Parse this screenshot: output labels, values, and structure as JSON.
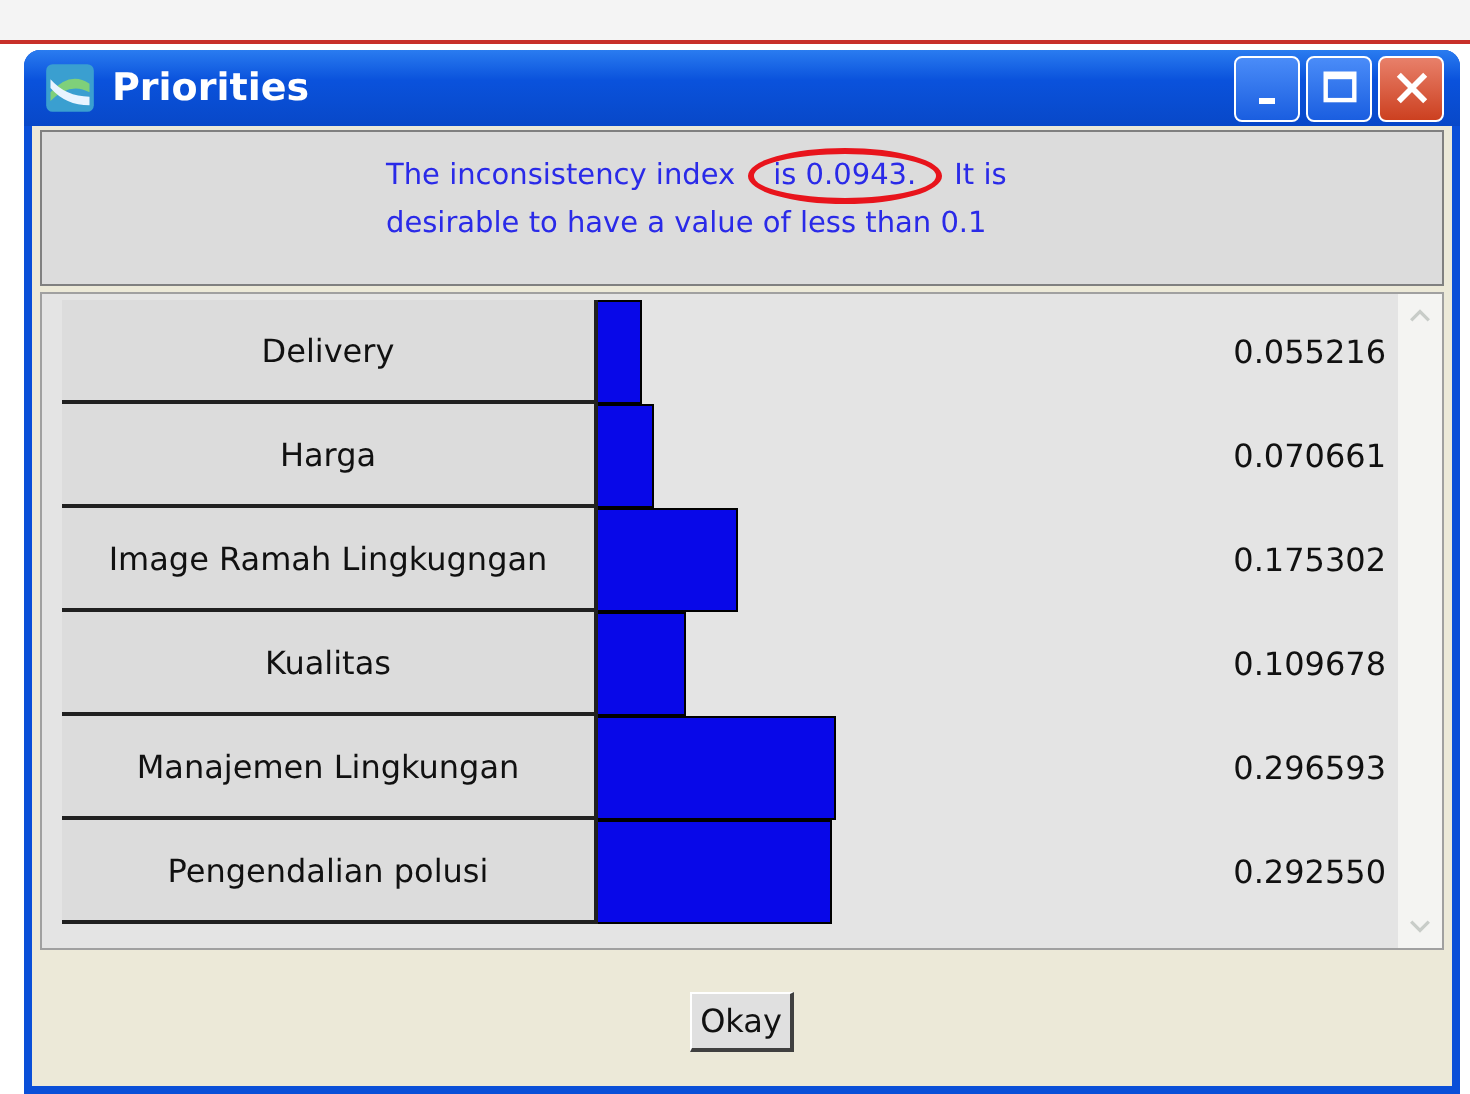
{
  "window": {
    "title": "Priorities"
  },
  "message": {
    "before": "The inconsistency index",
    "highlighted": "is 0.0943.",
    "after": "It is",
    "continuation": "desirable to have a value of less than 0.1"
  },
  "priorities": [
    {
      "name": "Delivery",
      "value": "0.055216"
    },
    {
      "name": "Harga",
      "value": "0.070661"
    },
    {
      "name": "Image Ramah Lingkugngan",
      "value": "0.175302"
    },
    {
      "name": "Kualitas",
      "value": "0.109678"
    },
    {
      "name": "Manajemen Lingkungan",
      "value": "0.296593"
    },
    {
      "name": "Pengendalian polusi",
      "value": "0.292550"
    }
  ],
  "buttons": [
    {
      "label": "Okay"
    }
  ]
}
